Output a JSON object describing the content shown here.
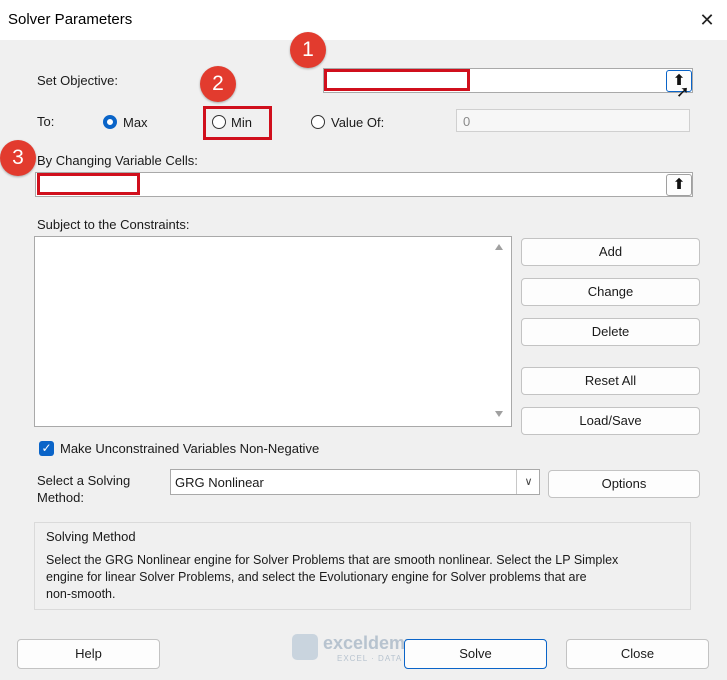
{
  "window": {
    "title": "Solver Parameters",
    "close_glyph": "✕"
  },
  "objective": {
    "label": "Set Objective:",
    "value": "",
    "ref_icon": "collapse-dialog-icon"
  },
  "to": {
    "label": "To:",
    "options": [
      {
        "label": "Max",
        "selected": true
      },
      {
        "label": "Min",
        "selected": false
      },
      {
        "label": "Value Of:",
        "selected": false
      }
    ],
    "value_of": "0"
  },
  "changing_cells": {
    "label": "By Changing Variable Cells:",
    "value": ""
  },
  "constraints": {
    "label": "Subject to the Constraints:",
    "buttons": {
      "add": "Add",
      "change": "Change",
      "delete": "Delete",
      "reset_all": "Reset All",
      "load_save": "Load/Save"
    }
  },
  "nonneg": {
    "label": "Make Unconstrained Variables Non-Negative",
    "checked": true
  },
  "method": {
    "label_line1": "Select a Solving",
    "label_line2": "Method:",
    "selected": "GRG Nonlinear",
    "options_button": "Options"
  },
  "solving_method": {
    "title": "Solving Method",
    "line1": "Select the GRG Nonlinear engine for Solver Problems that are smooth nonlinear. Select the LP Simplex",
    "line2": "engine for linear Solver Problems, and select the Evolutionary engine for Solver problems that are",
    "line3": "non-smooth."
  },
  "footer": {
    "help": "Help",
    "solve": "Solve",
    "close": "Close"
  },
  "annotations": {
    "badge1": "1",
    "badge2": "2",
    "badge3": "3",
    "accent": "#e23b2e"
  },
  "watermark": {
    "name": "exceldemy",
    "tagline": "EXCEL · DATA · BI"
  }
}
